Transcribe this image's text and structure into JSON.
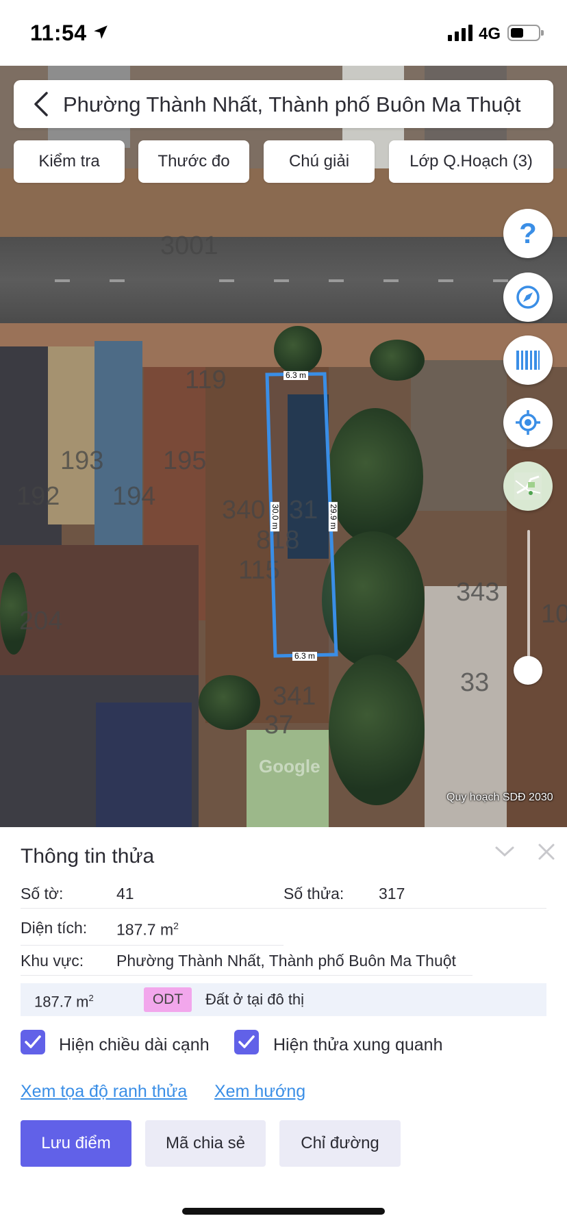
{
  "status_bar": {
    "time": "11:54",
    "network": "4G"
  },
  "search": {
    "title": "Phường Thành Nhất, Thành phố Buôn Ma Thuột"
  },
  "toolbar": {
    "check": "Kiểm tra",
    "ruler": "Thước đo",
    "legend": "Chú giải",
    "layers": "Lớp Q.Hoạch (3)"
  },
  "map": {
    "help_symbol": "?",
    "plot_numbers": [
      "3001",
      "119",
      "193",
      "195",
      "192",
      "194",
      "340",
      "31",
      "818",
      "115",
      "343",
      "10",
      "33",
      "204",
      "341",
      "37"
    ],
    "edge_labels": {
      "top": "6.3 m",
      "left": "30.0 m",
      "right": "29.9 m",
      "bottom": "6.3 m"
    },
    "watermark": "Google",
    "caption": "Quy hoạch SDĐ 2030",
    "parcel_color": "#3a8ee6"
  },
  "panel": {
    "title": "Thông tin thửa",
    "sheet_label": "Số tờ:",
    "sheet_value": "41",
    "parcel_label": "Số thửa:",
    "parcel_value": "317",
    "area_label": "Diện tích:",
    "area_value": "187.7 m",
    "area_sup": "2",
    "region_label": "Khu vực:",
    "region_value": "Phường Thành Nhất, Thành phố Buôn Ma Thuột",
    "landuse_area": "187.7 m",
    "landuse_sup": "2",
    "landuse_code": "ODT",
    "landuse_code_color": "#f2a7ec",
    "landuse_desc": "Đất ở tại đô thị",
    "show_edge_length": "Hiện chiều dài cạnh",
    "show_surrounding": "Hiện thửa xung quanh",
    "link_coords": "Xem tọa độ ranh thửa",
    "link_direction": "Xem hướng",
    "btn_save": "Lưu điểm",
    "btn_share": "Mã chia sẻ",
    "btn_directions": "Chỉ đường",
    "accent_color": "#6161e8"
  }
}
